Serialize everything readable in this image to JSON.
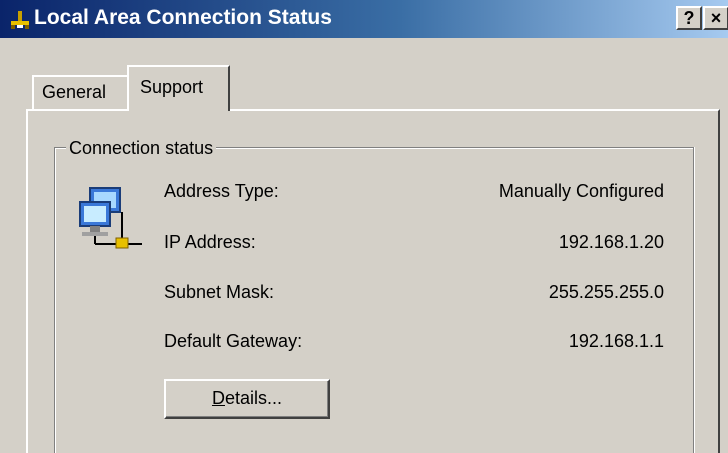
{
  "window": {
    "title": "Local Area Connection Status",
    "help_button": "?",
    "close_button": "×"
  },
  "tabs": [
    {
      "label": "General",
      "selected": false
    },
    {
      "label": "Support",
      "selected": true
    }
  ],
  "connection_status": {
    "group_label": "Connection status",
    "rows": [
      {
        "label": "Address Type:",
        "value": "Manually Configured"
      },
      {
        "label": "IP Address:",
        "value": "192.168.1.20"
      },
      {
        "label": "Subnet Mask:",
        "value": "255.255.255.0"
      },
      {
        "label": "Default Gateway:",
        "value": "192.168.1.1"
      }
    ],
    "details_button": {
      "mnemonic": "D",
      "rest": "etails..."
    }
  },
  "colors": {
    "title_bar_start": "#0a246a",
    "title_bar_end": "#a6caf0",
    "dialog_face": "#d4d0c8"
  },
  "icons": [
    "network-connection-icon",
    "network-computers-icon",
    "help-icon",
    "close-icon"
  ]
}
